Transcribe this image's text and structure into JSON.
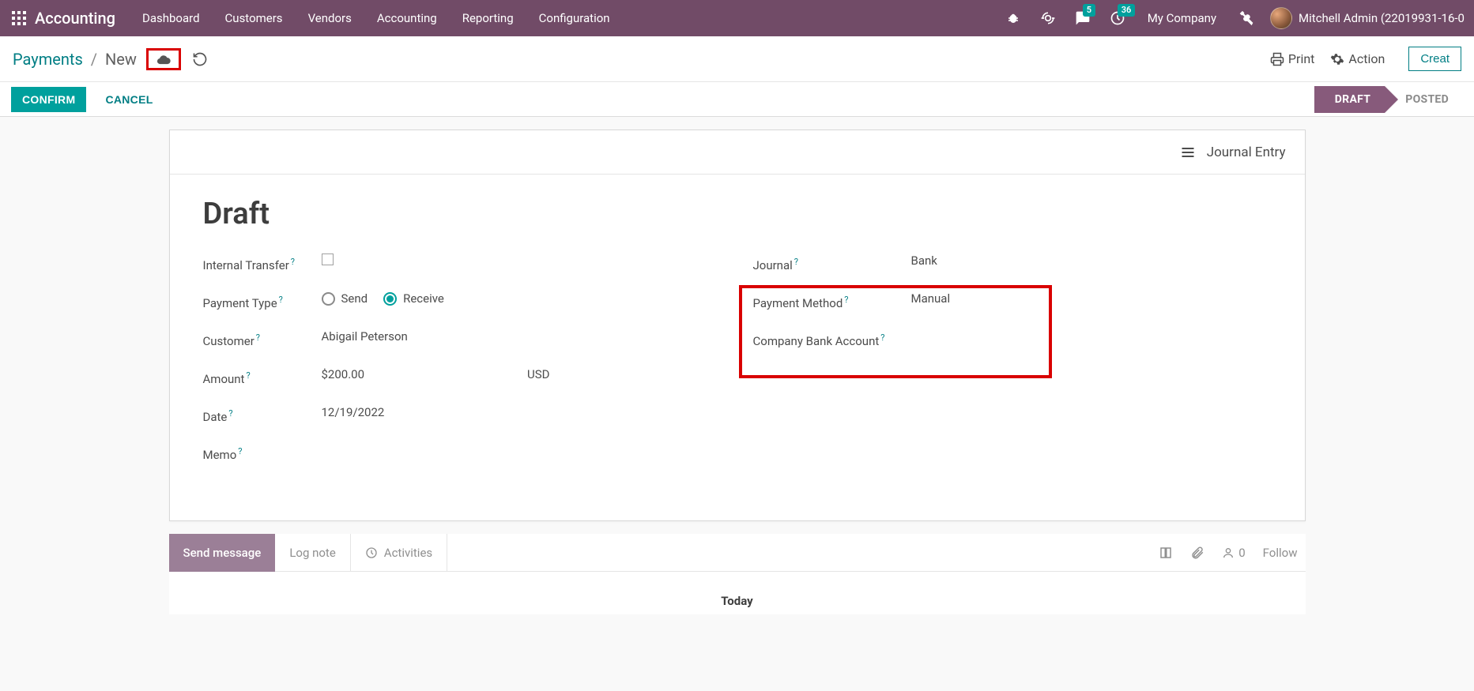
{
  "topnav": {
    "brand": "Accounting",
    "menu": [
      "Dashboard",
      "Customers",
      "Vendors",
      "Accounting",
      "Reporting",
      "Configuration"
    ],
    "messages_badge": "5",
    "activities_badge": "36",
    "company": "My Company",
    "user": "Mitchell Admin (22019931-16-0"
  },
  "breadcrumb": {
    "parent": "Payments",
    "current": "New"
  },
  "controlbar": {
    "print": "Print",
    "action": "Action",
    "create": "Creat"
  },
  "statusrow": {
    "confirm": "CONFIRM",
    "cancel": "CANCEL",
    "draft": "DRAFT",
    "posted": "POSTED"
  },
  "sheet": {
    "journal_entry": "Journal Entry",
    "title": "Draft",
    "labels": {
      "internal_transfer": "Internal Transfer",
      "payment_type": "Payment Type",
      "customer": "Customer",
      "amount": "Amount",
      "date": "Date",
      "memo": "Memo",
      "journal": "Journal",
      "payment_method": "Payment Method",
      "company_bank_account": "Company Bank Account"
    },
    "values": {
      "payment_type_send": "Send",
      "payment_type_receive": "Receive",
      "customer": "Abigail Peterson",
      "amount": "$200.00",
      "currency": "USD",
      "date": "12/19/2022",
      "journal": "Bank",
      "payment_method": "Manual"
    }
  },
  "chatter": {
    "send_message": "Send message",
    "log_note": "Log note",
    "activities": "Activities",
    "follower_count": "0",
    "follow": "Follow",
    "today": "Today"
  }
}
